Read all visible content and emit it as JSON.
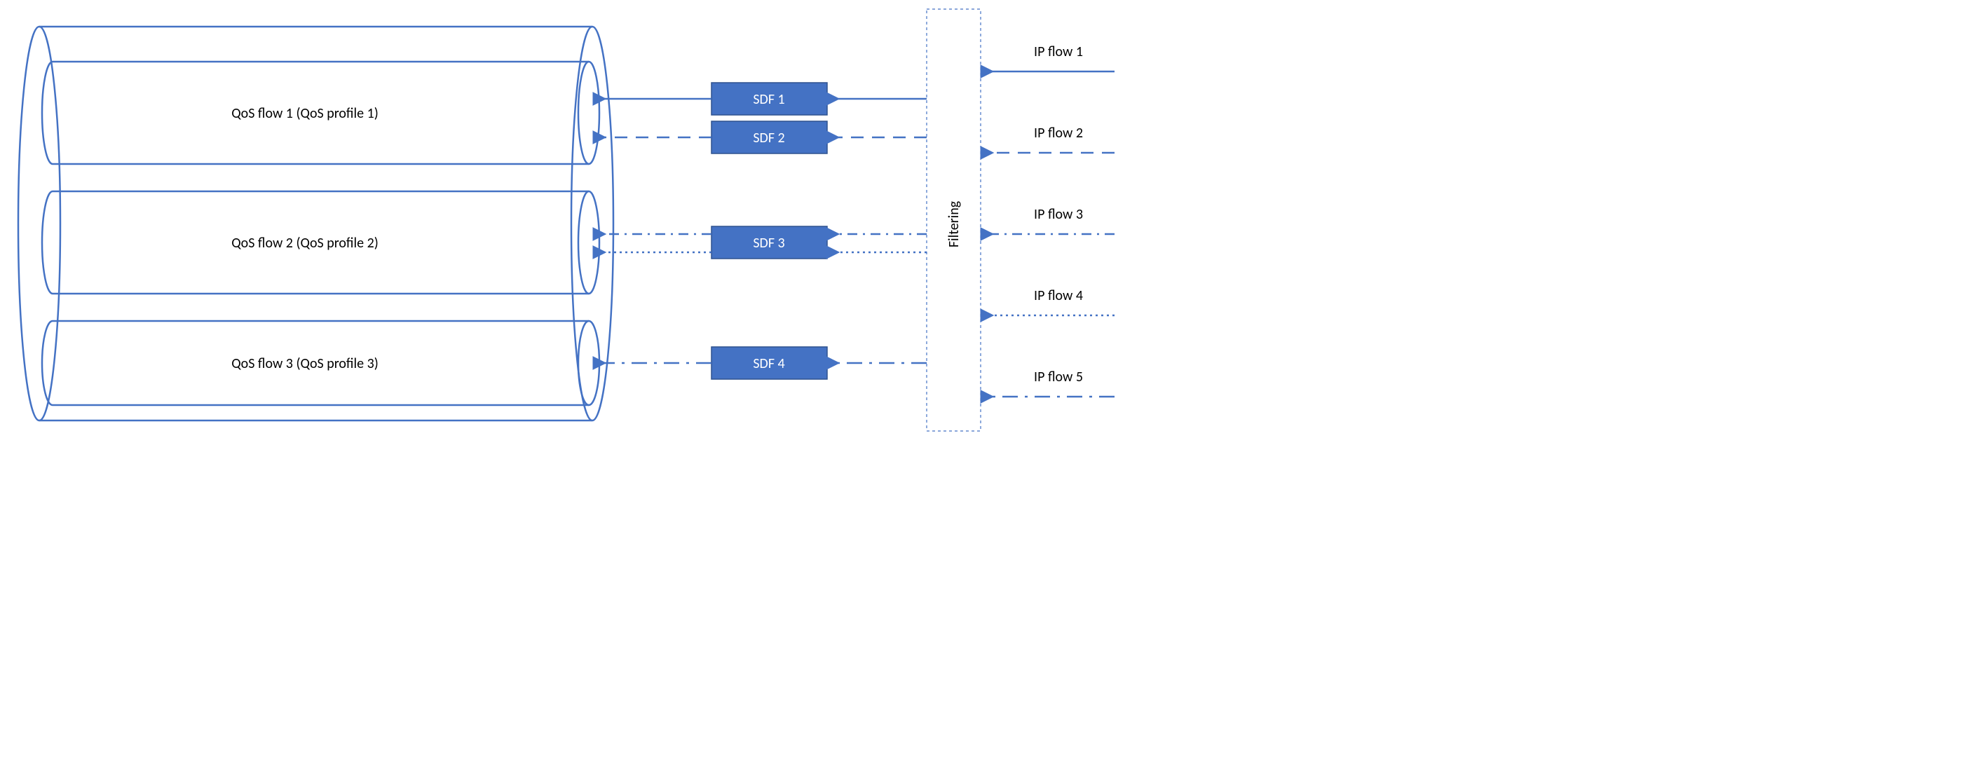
{
  "qos": [
    {
      "label": "QoS flow 1 (QoS profile 1)"
    },
    {
      "label": "QoS flow 2 (QoS profile 2)"
    },
    {
      "label": "QoS flow 3 (QoS profile 3)"
    }
  ],
  "sdf": [
    {
      "label": "SDF 1"
    },
    {
      "label": "SDF 2"
    },
    {
      "label": "SDF 3"
    },
    {
      "label": "SDF 4"
    }
  ],
  "ipflows": [
    {
      "label": "IP flow 1"
    },
    {
      "label": "IP flow 2"
    },
    {
      "label": "IP flow 3"
    },
    {
      "label": "IP flow 4"
    },
    {
      "label": "IP flow 5"
    }
  ],
  "filter": {
    "label": "Filtering"
  },
  "colors": {
    "accent": "#4472C4",
    "accent_dark": "#2F528F"
  },
  "chart_data": {
    "type": "diagram",
    "title": "5G QoS flow mapping: IP flows → Filtering → SDFs → QoS flows",
    "nodes": {
      "ip_flows": [
        "IP flow 1",
        "IP flow 2",
        "IP flow 3",
        "IP flow 4",
        "IP flow 5"
      ],
      "filter": "Filtering",
      "sdfs": [
        "SDF 1",
        "SDF 2",
        "SDF 3",
        "SDF 4"
      ],
      "qos_flows": [
        "QoS flow 1 (QoS profile 1)",
        "QoS flow 2 (QoS profile 2)",
        "QoS flow 3 (QoS profile 3)"
      ]
    },
    "edges_ip_to_sdf": [
      {
        "from": "IP flow 1",
        "to": "SDF 1",
        "style": "solid"
      },
      {
        "from": "IP flow 2",
        "to": "SDF 2",
        "style": "long-dash"
      },
      {
        "from": "IP flow 3",
        "to": "SDF 3",
        "style": "dash-dot"
      },
      {
        "from": "IP flow 4",
        "to": "SDF 3",
        "style": "dotted"
      },
      {
        "from": "IP flow 5",
        "to": "SDF 4",
        "style": "long-dash-dot"
      }
    ],
    "edges_sdf_to_qos": [
      {
        "from": "SDF 1",
        "to": "QoS flow 1",
        "style": "solid"
      },
      {
        "from": "SDF 2",
        "to": "QoS flow 1",
        "style": "long-dash"
      },
      {
        "from": "SDF 3",
        "to": "QoS flow 2",
        "style": "dash-dot"
      },
      {
        "from": "SDF 3",
        "to": "QoS flow 2",
        "style": "dotted"
      },
      {
        "from": "SDF 4",
        "to": "QoS flow 3",
        "style": "long-dash-dot"
      }
    ]
  }
}
